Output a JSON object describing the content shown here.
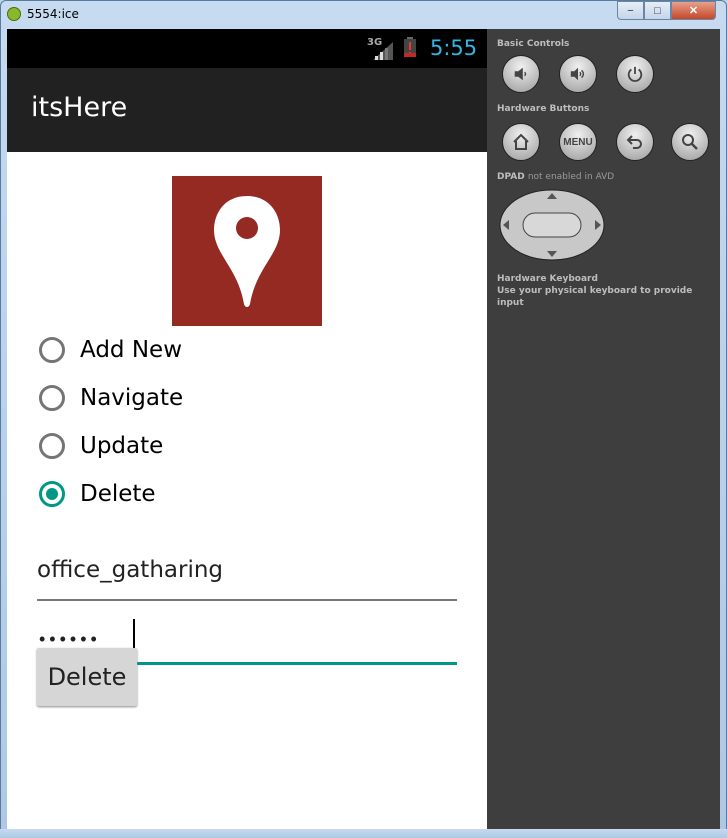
{
  "window": {
    "title": "5554:ice",
    "minimize_glyph": "−",
    "maximize_glyph": "□",
    "close_glyph": "✕"
  },
  "status_bar": {
    "network": "3G",
    "time": "5:55",
    "clock_color": "#33b5e5"
  },
  "action_bar": {
    "title": "itsHere"
  },
  "logo": {
    "icon": "map-pin-icon",
    "background": "#942a22"
  },
  "radio_options": [
    {
      "label": "Add New",
      "checked": false
    },
    {
      "label": "Navigate",
      "checked": false
    },
    {
      "label": "Update",
      "checked": false
    },
    {
      "label": "Delete",
      "checked": true
    }
  ],
  "name_field": {
    "value": "office_gatharing"
  },
  "password_field": {
    "value": "••••••"
  },
  "delete_button": {
    "label": "Delete"
  },
  "accent_color": "#009688",
  "emulator_panel": {
    "basic_controls_label": "Basic Controls",
    "hardware_buttons_label": "Hardware Buttons",
    "menu_label": "MENU",
    "dpad_label": "DPAD",
    "dpad_note": "not enabled in AVD",
    "keyboard_title": "Hardware Keyboard",
    "keyboard_desc": "Use your physical keyboard to provide input"
  }
}
